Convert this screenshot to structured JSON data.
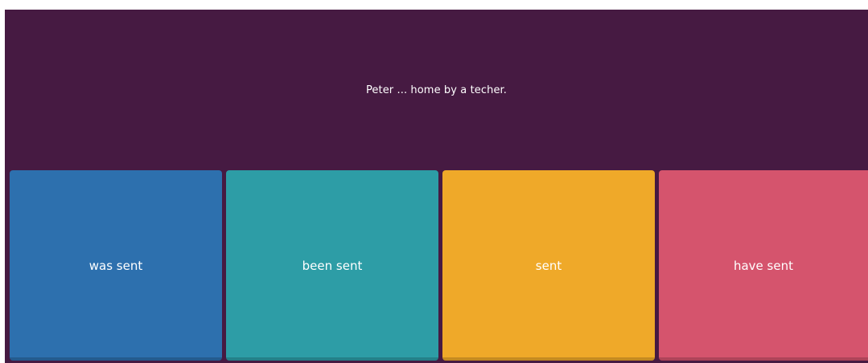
{
  "question": {
    "text": "Peter ... home by a techer."
  },
  "answers": [
    {
      "label": "was sent",
      "color": "#2d70ae"
    },
    {
      "label": "been sent",
      "color": "#2d9da6"
    },
    {
      "label": "sent",
      "color": "#efa929"
    },
    {
      "label": "have sent",
      "color": "#d5546d"
    }
  ],
  "colors": {
    "background": "#461a42"
  }
}
